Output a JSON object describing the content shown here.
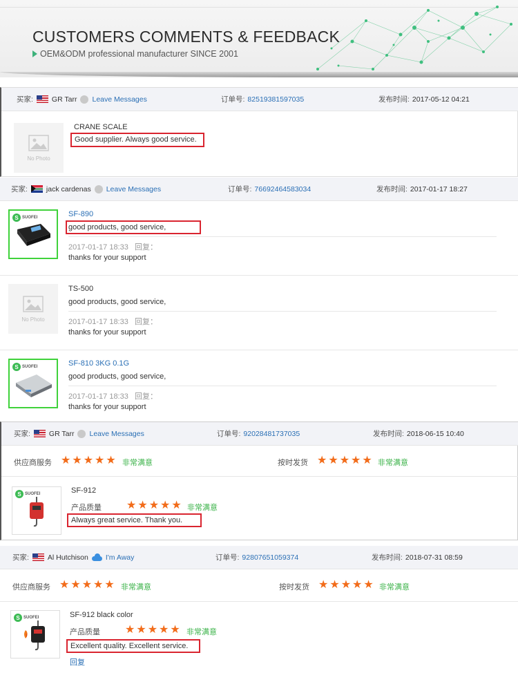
{
  "banner": {
    "title": "CUSTOMERS COMMENTS & FEEDBACK",
    "subtitle": "OEM&ODM professional manufacturer SINCE 2001"
  },
  "labels": {
    "buyer": "买家:",
    "order": "订单号:",
    "time": "发布时间:",
    "supplier_service": "供应商服务",
    "on_time": "按时发货",
    "quality": "产品质量",
    "satisfied": "非常满意",
    "reply": "回复：",
    "reply_link": "回复",
    "no_photo": "No Photo",
    "brand": "SUOFEI"
  },
  "reviews": [
    {
      "buyer": "GR Tarr",
      "flag": "us",
      "action": "Leave Messages",
      "order_no": "82519381597035",
      "time": "2017-05-12 04:21",
      "product": "CRANE SCALE",
      "comment": "Good supplier. Always good service."
    },
    {
      "buyer": "jack cardenas",
      "flag": "za",
      "action": "Leave Messages",
      "order_no": "76692464583034",
      "time": "2017-01-17 18:27",
      "items": [
        {
          "product": "SF-890",
          "comment": "good products, good service,",
          "reply_time": "2017-01-17 18:33",
          "reply": "thanks for your support"
        },
        {
          "product": "TS-500",
          "comment": "good products, good service,",
          "reply_time": "2017-01-17 18:33",
          "reply": "thanks for your support"
        },
        {
          "product": "SF-810 3KG 0.1G",
          "comment": "good products, good service,",
          "reply_time": "2017-01-17 18:33",
          "reply": "thanks for your support"
        }
      ]
    },
    {
      "buyer": "GR Tarr",
      "flag": "us",
      "action": "Leave Messages",
      "order_no": "92028481737035",
      "time": "2018-06-15 10:40",
      "supplier_rating": 5,
      "shipping_rating": 5,
      "product": "SF-912",
      "quality_rating": 5,
      "comment": "Always great service. Thank you."
    },
    {
      "buyer": "Al Hutchison",
      "flag": "us",
      "action": "I'm Away",
      "order_no": "92807651059374",
      "time": "2018-07-31 08:59",
      "supplier_rating": 5,
      "shipping_rating": 5,
      "product": "SF-912 black color",
      "quality_rating": 5,
      "comment": "Excellent quality. Excellent service."
    }
  ],
  "colors": {
    "link": "#2a6fb5",
    "star": "#f26c1a",
    "satisfied": "#3cb34a",
    "highlight_box": "#d9242f",
    "header_bg": "#f2f3f7"
  }
}
